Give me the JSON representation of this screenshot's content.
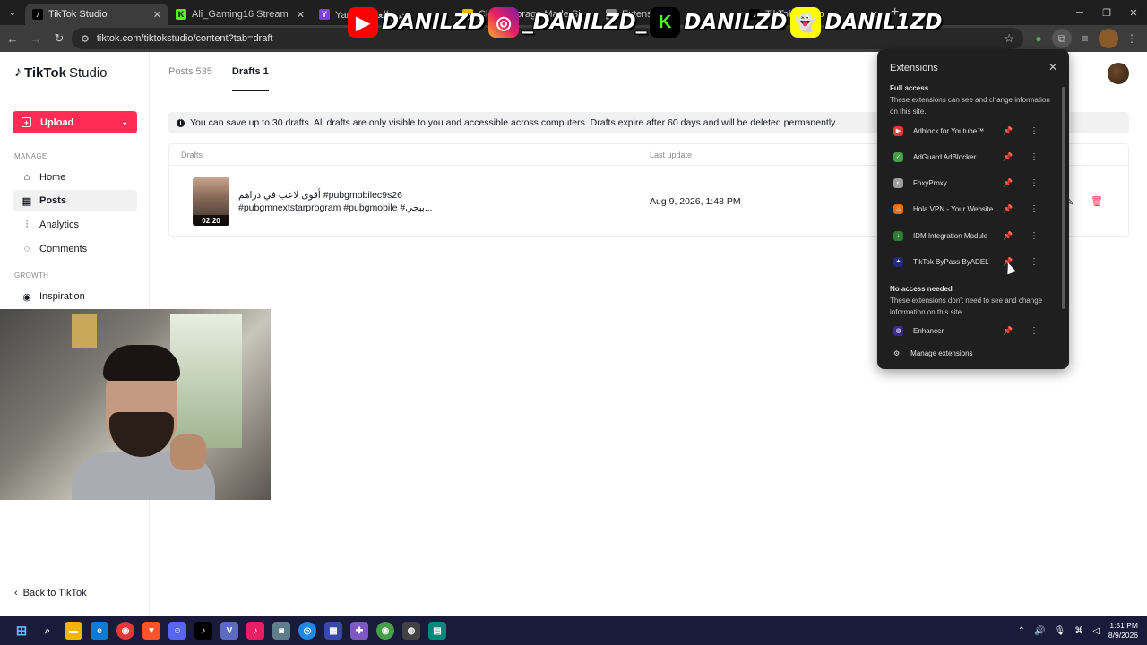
{
  "browser": {
    "tabs": [
      {
        "label": "TikTok Studio",
        "icon": "tiktok-icon",
        "color": "#000000"
      },
      {
        "label": "Ali_Gaming16 Stream - Watch L",
        "icon": "kick-icon",
        "color": "#53fc18"
      },
      {
        "label": "Yamli محرر العربي",
        "icon": "yamli-icon",
        "color": "#7b3fe4"
      },
      {
        "label": "Cloud Storage Made Si",
        "icon": "folder-icon",
        "color": "#f5b400"
      },
      {
        "label": "Extensions",
        "icon": "puzzle-icon",
        "color": "#888888"
      },
      {
        "label": "TikTok Studio",
        "icon": "tiktok-icon",
        "color": "#000000"
      }
    ],
    "url": "tiktok.com/tiktokstudio/content?tab=draft"
  },
  "overlay": {
    "youtube": "DANILZD",
    "instagram": "_DANILZD_",
    "kick": "DANILZD",
    "snapchat": "DANIL1ZD"
  },
  "sidebar": {
    "logo": "TikTok",
    "logo_suffix": "Studio",
    "upload_label": "Upload",
    "manage_label": "MANAGE",
    "growth_label": "GROWTH",
    "items": [
      {
        "label": "Home"
      },
      {
        "label": "Posts"
      },
      {
        "label": "Analytics"
      },
      {
        "label": "Comments"
      },
      {
        "label": "Inspiration"
      }
    ],
    "back_label": "Back to TikTok"
  },
  "main": {
    "tabs": [
      {
        "label": "Posts",
        "count": "535"
      },
      {
        "label": "Drafts",
        "count": "1"
      }
    ],
    "notice": "You can save up to 30 drafts. All drafts are only visible to you and accessible across computers. Drafts expire after 60 days and will be deleted permanently.",
    "columns": {
      "drafts": "Drafts",
      "last_update": "Last update"
    },
    "rows": [
      {
        "caption_line1": "أقوى لاعب في دراهم #pubgmobilec9s26",
        "caption_line2": "#pubgmnextstarprogram #pubgmobile #ببجي...",
        "duration": "02:20",
        "last_update": "Aug 9, 2026, 1:48 PM"
      }
    ]
  },
  "extensions": {
    "title": "Extensions",
    "full_access_title": "Full access",
    "full_access_desc": "These extensions can see and change information on this site.",
    "full_access": [
      {
        "name": "Adblock for Youtube™",
        "color": "#e53935"
      },
      {
        "name": "AdGuard AdBlocker",
        "color": "#43a047"
      },
      {
        "name": "FoxyProxy",
        "color": "#9e9e9e"
      },
      {
        "name": "Hola VPN - Your Website Unblocker",
        "color": "#ef6c00"
      },
      {
        "name": "IDM Integration Module",
        "color": "#2e7d32"
      },
      {
        "name": "TikTok ByPass ByADEL",
        "color": "#1e2a78"
      }
    ],
    "no_access_title": "No access needed",
    "no_access_desc": "These extensions don't need to see and change information on this site.",
    "no_access": [
      {
        "name": "Enhancer",
        "color": "#3b2a8a"
      }
    ],
    "manage_label": "Manage extensions"
  },
  "taskbar": {
    "time": "1:51 PM",
    "date": "8/9/2026"
  }
}
